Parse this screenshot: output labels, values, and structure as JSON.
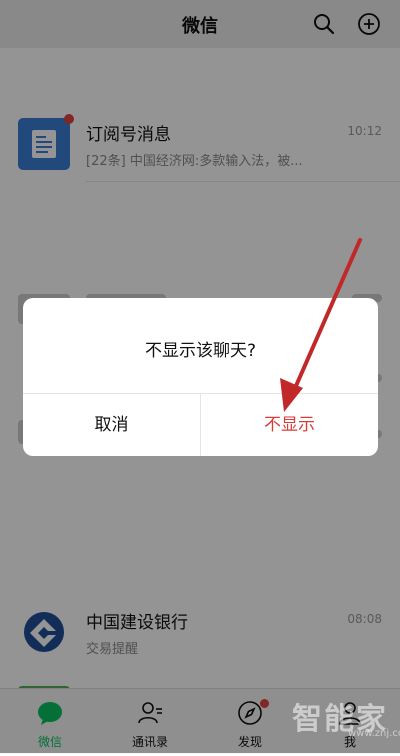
{
  "header": {
    "title": "微信",
    "search_icon": "search-icon",
    "add_icon": "plus-circle-icon"
  },
  "chats": [
    {
      "name": "订阅号消息",
      "preview": "[22条] 中国经济网:多款输入法，被...",
      "time": "10:12",
      "has_dot": true
    },
    {
      "name": "中国建设银行",
      "preview": "交易提醒",
      "time": "08:08"
    }
  ],
  "dialog": {
    "message": "不显示该聊天?",
    "cancel_label": "取消",
    "confirm_label": "不显示"
  },
  "tabs": [
    {
      "label": "微信",
      "icon": "chat-bubble-icon",
      "active": true
    },
    {
      "label": "通讯录",
      "icon": "contacts-icon"
    },
    {
      "label": "发现",
      "icon": "compass-icon",
      "has_dot": true
    },
    {
      "label": "我",
      "icon": "person-icon"
    }
  ],
  "colors": {
    "accent": "#07c160",
    "danger": "#d93a3a",
    "arrow": "#c0282a"
  },
  "watermark": {
    "main": "智能家",
    "sub": "www.znj.com"
  }
}
